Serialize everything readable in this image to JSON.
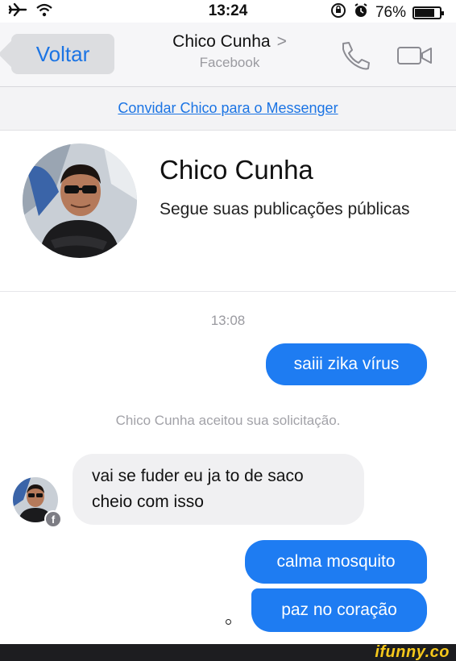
{
  "status_bar": {
    "time": "13:24",
    "battery": "76%",
    "left_icons": [
      "airplane-icon",
      "wifi-icon"
    ],
    "right_icons": [
      "orientation-lock-icon",
      "alarm-icon",
      "battery-icon"
    ]
  },
  "nav": {
    "back_label": "Voltar",
    "title": "Chico Cunha",
    "title_chevron": ">",
    "subtitle": "Facebook",
    "icons": [
      "phone-icon",
      "video-camera-icon"
    ],
    "accent_color": "#1b74e4"
  },
  "invite_banner": {
    "link_text": "Convidar Chico para o Messenger"
  },
  "profile": {
    "name": "Chico Cunha",
    "subtitle": "Segue suas publicações públicas"
  },
  "chat": {
    "timestamp": "13:08",
    "system_message": "Chico Cunha aceitou sua solicitação.",
    "messages": [
      {
        "sender": "me",
        "text": "saiii zika vírus"
      },
      {
        "sender": "Chico Cunha",
        "text": "vai se fuder eu ja to de saco cheio com isso"
      },
      {
        "sender": "me",
        "text": "calma mosquito"
      },
      {
        "sender": "me",
        "text": "paz no coração"
      }
    ],
    "outgoing_color": "#1e7cf2",
    "incoming_color": "#f0f0f2"
  },
  "watermark": {
    "text": "ifunny.co"
  }
}
